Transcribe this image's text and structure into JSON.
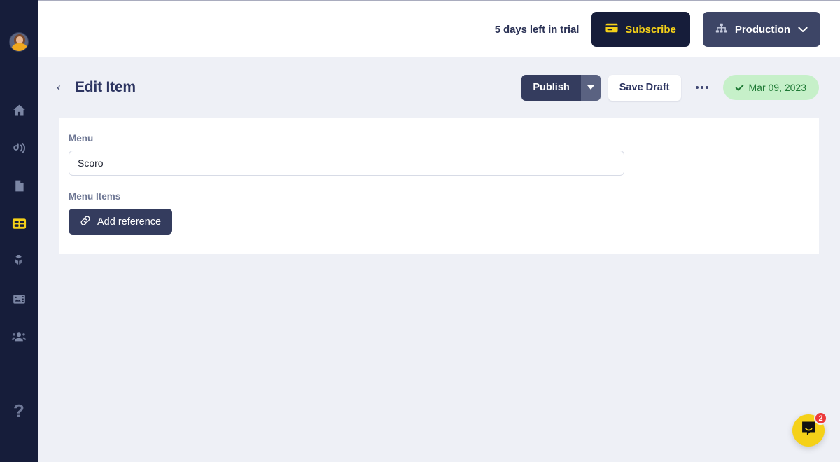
{
  "sidebar": {
    "avatar": {
      "name": "user-avatar",
      "alt": "User avatar"
    },
    "items": [
      {
        "icon": "home-icon",
        "name": "sidebar-item-home",
        "active": false
      },
      {
        "icon": "blog-icon",
        "name": "sidebar-item-blog",
        "active": false
      },
      {
        "icon": "pages-icon",
        "name": "sidebar-item-pages",
        "active": false
      },
      {
        "icon": "grid-icon",
        "name": "sidebar-item-content",
        "active": true
      },
      {
        "icon": "blocks-icon",
        "name": "sidebar-item-models",
        "active": false
      },
      {
        "icon": "media-icon",
        "name": "sidebar-item-media",
        "active": false
      },
      {
        "icon": "users-icon",
        "name": "sidebar-item-users",
        "active": false
      }
    ],
    "help_label": "?"
  },
  "topbar": {
    "trial_text": "5 days left in trial",
    "subscribe_label": "Subscribe",
    "subscribe_icon": "credit-card-icon",
    "environment_label": "Production",
    "environment_icon": "sitemap-icon",
    "environment_caret": "chevron-down-icon"
  },
  "pagehead": {
    "back_label": "‹",
    "title": "Edit Item",
    "publish_label": "Publish",
    "publish_caret": "chevron-down-icon",
    "save_draft_label": "Save Draft",
    "more_label": "more-options",
    "date_badge": "Mar 09, 2023"
  },
  "form": {
    "fields": [
      {
        "label": "Menu",
        "value": "Scoro",
        "placeholder": ""
      }
    ],
    "menu_items_label": "Menu Items",
    "add_reference_label": "Add reference",
    "add_reference_icon": "link-icon"
  },
  "chat": {
    "icon": "chat-bubble-icon",
    "badge_count": "2"
  },
  "colors": {
    "sidebar_bg": "#161d3a",
    "accent_yellow": "#f5d118",
    "page_bg": "#eef0f6",
    "dark_button": "#343c5e",
    "env_button": "#3d4566",
    "badge_green_bg": "#c6f0c9",
    "badge_green_text": "#1f7a35",
    "badge_red": "#ec3a3a"
  }
}
